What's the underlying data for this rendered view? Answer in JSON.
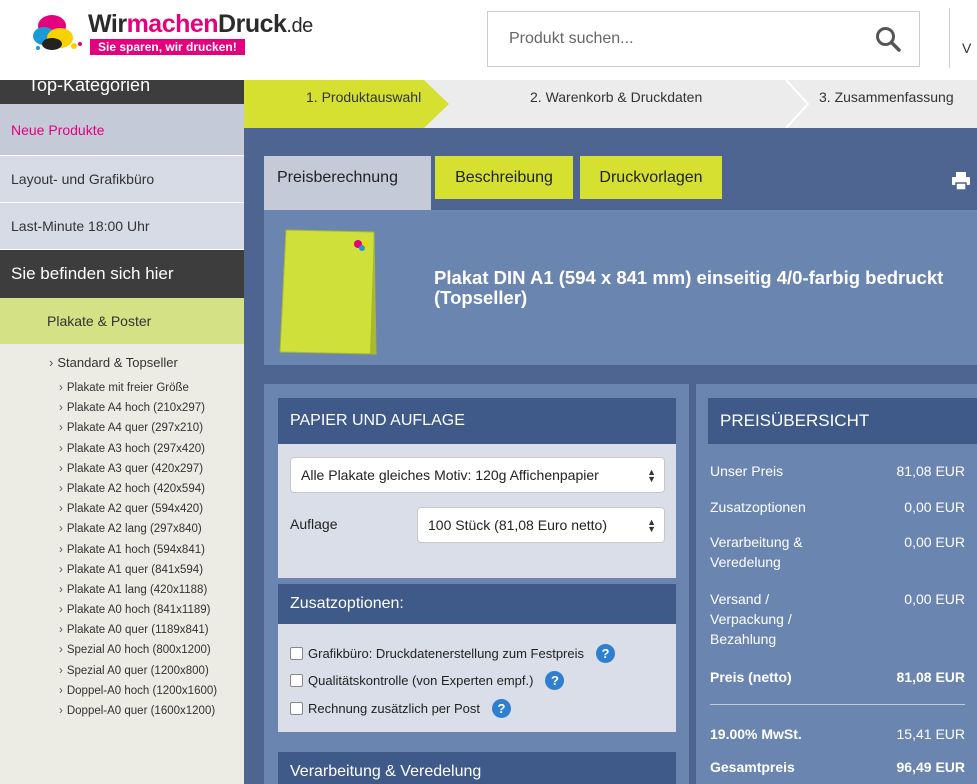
{
  "header": {
    "brand_part1": "Wir",
    "brand_part2": "machen",
    "brand_part3": "Druck",
    "brand_tld": ".de",
    "slogan": "Sie sparen, wir drucken!",
    "search_placeholder": "Produkt suchen...",
    "cut_text": "V"
  },
  "sidebar": {
    "top_categories": "Top-Kategorien",
    "new_products": "Neue Produkte",
    "items": [
      "Layout- und Grafikbüro",
      "Last-Minute 18:00 Uhr"
    ],
    "you_are_here": "Sie befinden sich hier",
    "category": "Plakate & Poster",
    "subcategory": "Standard & Topseller",
    "list": [
      "Plakate mit freier Größe",
      "Plakate A4 hoch (210x297)",
      "Plakate A4 quer (297x210)",
      "Plakate A3 hoch (297x420)",
      "Plakate A3 quer (420x297)",
      "Plakate A2 hoch (420x594)",
      "Plakate A2 quer (594x420)",
      "Plakate A2 lang (297x840)",
      "Plakate A1 hoch (594x841)",
      "Plakate A1 quer (841x594)",
      "Plakate A1 lang (420x1188)",
      "Plakate A0 hoch (841x1189)",
      "Plakate A0 quer (1189x841)",
      "Spezial A0 hoch (800x1200)",
      "Spezial A0 quer (1200x800)",
      "Doppel-A0 hoch (1200x1600)",
      "Doppel-A0 quer (1600x1200)"
    ]
  },
  "steps": [
    "1. Produktauswahl",
    "2. Warenkorb & Druckdaten",
    "3. Zusammenfassung"
  ],
  "tabs": [
    "Preisberechnung",
    "Beschreibung",
    "Druckvorlagen"
  ],
  "product": {
    "title": "Plakat DIN A1 (594 x 841 mm) einseitig 4/0-farbig bedruckt (Topseller)"
  },
  "paper": {
    "heading": "PAPIER UND AUFLAGE",
    "material_value": "Alle Plakate gleiches Motiv: 120g Affichenpapier",
    "quantity_label": "Auflage",
    "quantity_value": "100 Stück (81,08 Euro netto)"
  },
  "options": {
    "heading": "Zusatzoptionen:",
    "items": [
      "Grafikbüro: Druckdatenerstellung zum Festpreis",
      "Qualitätskontrolle (von Experten empf.)",
      "Rechnung zusätzlich per Post"
    ],
    "help_glyph": "?"
  },
  "finishing": {
    "heading": "Verarbeitung & Veredelung"
  },
  "price": {
    "heading": "PREISÜBERSICHT",
    "rows": [
      {
        "label": "Unser Preis",
        "value": "81,08 EUR"
      },
      {
        "label": "Zusatzoptionen",
        "value": "0,00 EUR"
      },
      {
        "label": "Verarbeitung & Veredelung",
        "value": "0,00 EUR"
      },
      {
        "label": "Versand / Verpackung / Bezahlung",
        "value": "0,00 EUR"
      },
      {
        "label": "Preis (netto)",
        "value": "81,08 EUR"
      },
      {
        "label": "19.00% MwSt.",
        "value": "15,41 EUR"
      },
      {
        "label": "Gesamtpreis",
        "value": "96,49 EUR"
      }
    ]
  },
  "colors": {
    "brand_pink": "#e5007d",
    "accent_yellow": "#d5e030",
    "main_blue": "#4d6590",
    "panel_blue": "#6b85b1",
    "header_blue": "#3f5a88"
  }
}
